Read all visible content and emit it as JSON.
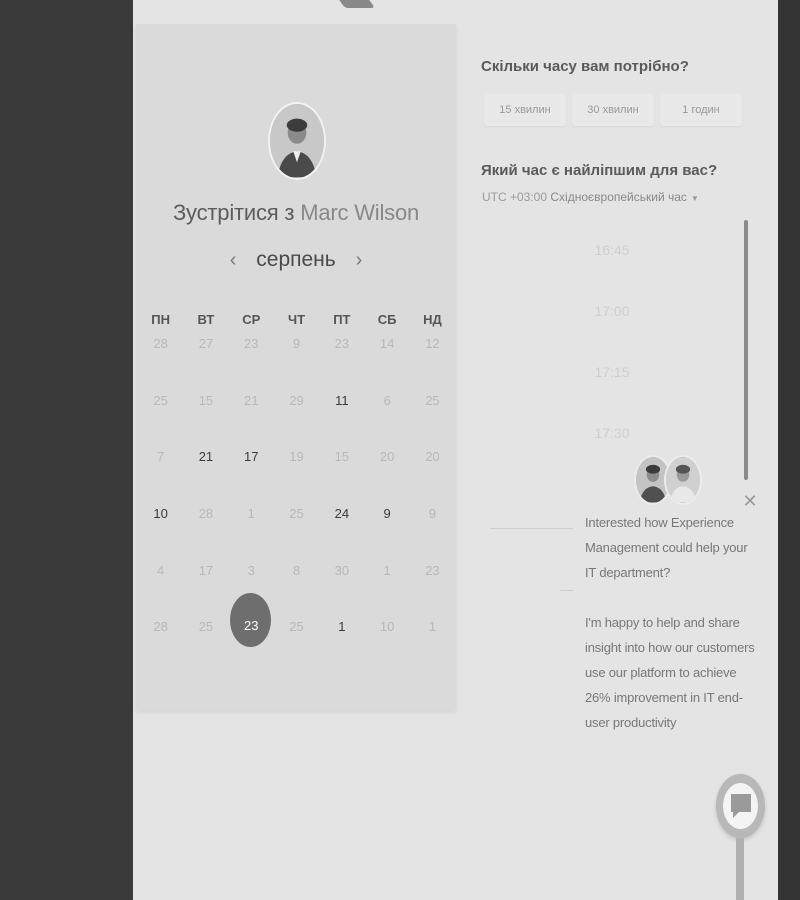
{
  "scheduler": {
    "title_prefix": "Зустрітися з",
    "host_name": "Marc Wilson",
    "month": "серпень",
    "prev_icon": "‹",
    "next_icon": "›",
    "weekdays": [
      "ПН",
      "ВТ",
      "СР",
      "ЧТ",
      "ПТ",
      "СБ",
      "НД"
    ],
    "weeks": [
      [
        "28",
        "27",
        "23",
        "9",
        "23",
        "14",
        "12"
      ],
      [
        "25",
        "15",
        "21",
        "29",
        "11",
        "6",
        "25"
      ],
      [
        "7",
        "21",
        "17",
        "19",
        "15",
        "20",
        "20"
      ],
      [
        "10",
        "28",
        "1",
        "25",
        "24",
        "9",
        "9"
      ],
      [
        "4",
        "17",
        "3",
        "8",
        "30",
        "1",
        "23"
      ],
      [
        "28",
        "25",
        "23",
        "25",
        "1",
        "10",
        "1"
      ]
    ],
    "available_days": [
      "11",
      "21",
      "17",
      "10",
      "24",
      "9",
      "1"
    ],
    "selected_day": "23"
  },
  "duration": {
    "question": "Скільки часу вам потрібно?",
    "options": [
      "15 хвилин",
      "30 хвилин",
      "1 годин"
    ]
  },
  "time": {
    "question": "Який час є найліпшим для вас?",
    "timezone_offset": "UTC +03:00",
    "timezone_name": "Східноєвропейський час",
    "slots": [
      "16:45",
      "17:00",
      "17:15",
      "17:30"
    ]
  },
  "chat": {
    "message_1": "Interested how Experience Management could help your IT department?",
    "message_2": "I'm happy to help and share insight into how our customers use our platform to achieve 26% improvement in IT end-user productivity",
    "close_icon": "close-icon"
  },
  "colors": {
    "selected_day_bg": "#6e6e6e",
    "page_bg": "#e4e4e4",
    "panel_bg": "#dadada"
  }
}
